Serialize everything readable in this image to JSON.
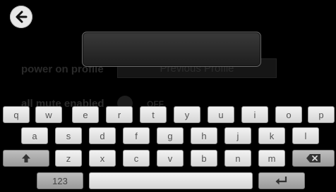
{
  "header": {
    "back_icon": "back-arrow-icon"
  },
  "background_settings": {
    "power_on_profile_label": "power on profile",
    "power_on_profile_value": "Previous Profile",
    "all_mute_label": "all mute enabled",
    "all_mute_value": "OFF"
  },
  "input": {
    "value": ""
  },
  "keyboard": {
    "row1": [
      "q",
      "w",
      "e",
      "r",
      "t",
      "y",
      "u",
      "i",
      "o",
      "p"
    ],
    "row2": [
      "a",
      "s",
      "d",
      "f",
      "g",
      "h",
      "j",
      "k",
      "l"
    ],
    "row3": [
      "z",
      "x",
      "c",
      "v",
      "b",
      "n",
      "m"
    ],
    "shift_icon": "shift-arrow-icon",
    "delete_icon": "backspace-icon",
    "numbers_label": "123",
    "space_label": "",
    "enter_icon": "enter-icon"
  }
}
